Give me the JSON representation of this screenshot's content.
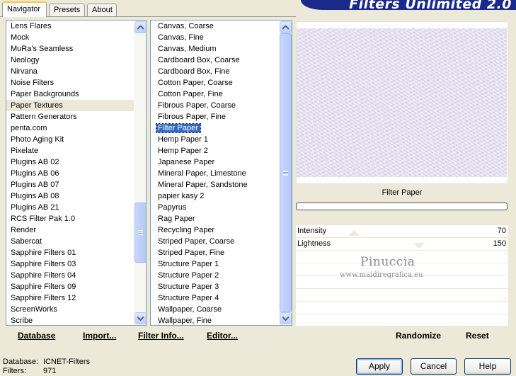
{
  "tabs": [
    {
      "label": "Navigator",
      "active": true
    },
    {
      "label": "Presets",
      "active": false
    },
    {
      "label": "About",
      "active": false
    }
  ],
  "banner": {
    "title": "Filters Unlimited 2.0",
    "color": "#1a2a8c"
  },
  "categories": {
    "items": [
      "Lens Flares",
      "Mock",
      "MuRa's Seamless",
      "Neology",
      "Nirvana",
      "Noise Filters",
      "Paper Backgrounds",
      "Paper Textures",
      "Pattern Generators",
      "penta.com",
      "Photo Aging Kit",
      "Pixelate",
      "Plugins AB 02",
      "Plugins AB 06",
      "Plugins AB 07",
      "Plugins AB 08",
      "Plugins AB 21",
      "RCS Filter Pak 1.0",
      "Render",
      "Sabercat",
      "Sapphire Filters 01",
      "Sapphire Filters 03",
      "Sapphire Filters 04",
      "Sapphire Filters 09",
      "Sapphire Filters 12",
      "ScreenWorks",
      "Scribe"
    ],
    "selected": "Paper Textures"
  },
  "filters": {
    "items": [
      "Canvas, Coarse",
      "Canvas, Fine",
      "Canvas, Medium",
      "Cardboard Box, Coarse",
      "Cardboard Box, Fine",
      "Cotton Paper, Coarse",
      "Cotton Paper, Fine",
      "Fibrous Paper, Coarse",
      "Fibrous Paper, Fine",
      "Filter Paper",
      "Hemp Paper 1",
      "Hemp Paper 2",
      "Japanese Paper",
      "Mineral Paper, Limestone",
      "Mineral Paper, Sandstone",
      "papier kasy 2",
      "Papyrus",
      "Rag Paper",
      "Recycling Paper",
      "Striped Paper, Coarse",
      "Striped Paper, Fine",
      "Structure Paper 1",
      "Structure Paper 2",
      "Structure Paper 3",
      "Structure Paper 4",
      "Wallpaper, Coarse",
      "Wallpaper, Fine"
    ],
    "selected": "Filter Paper"
  },
  "toolbar": {
    "database": "Database",
    "import": "Import...",
    "filter_info": "Filter Info...",
    "editor": "Editor...",
    "randomize": "Randomize",
    "reset": "Reset"
  },
  "preview": {
    "filter_name": "Filter Paper",
    "texture_color": "#e4e0ef",
    "progress": 0
  },
  "params": [
    {
      "label": "Intensity",
      "value": "70"
    },
    {
      "label": "Lightness",
      "value": "150"
    }
  ],
  "watermark": {
    "name": "Pinuccia",
    "site": "www.maidiregrafica.eu"
  },
  "status": {
    "database_label": "Database:",
    "database_value": "ICNET-Filters",
    "filters_label": "Filters:",
    "filters_value": "971"
  },
  "dialog_buttons": {
    "apply": "Apply",
    "cancel": "Cancel",
    "help": "Help"
  }
}
